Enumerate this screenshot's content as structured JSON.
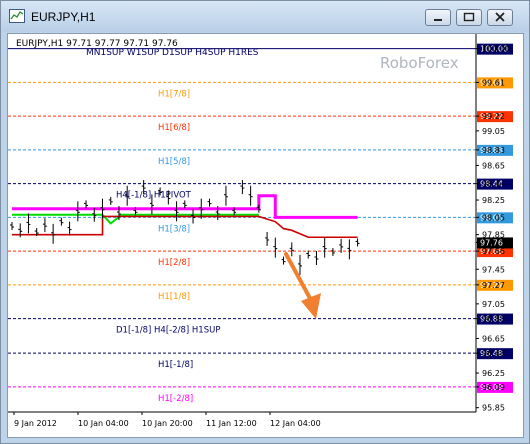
{
  "window": {
    "title": "EURJPY,H1",
    "icon": "chart-window-icon",
    "controls": [
      "minimize-icon",
      "maximize-icon",
      "close-icon"
    ]
  },
  "chart_info": {
    "symbol_line": "EURJPY,H1  97.71 97.77 97.71 97.76",
    "levels_line": "MN1SUP W1SUP D1SUP H4SUP H1RES",
    "watermark": "RoboForex"
  },
  "colors": {
    "navy": "#000066",
    "orange": "#ff9900",
    "red": "#ff3300",
    "blue": "#3399dd",
    "magenta": "#ff00ff",
    "green": "#00dd00",
    "darkred": "#cc0000",
    "arrow": "#f08030"
  },
  "chart_data": {
    "type": "line",
    "ylim": [
      95.8,
      100.1
    ],
    "y_ticks": [
      "100.00",
      "99.61",
      "99.22",
      "99.05",
      "98.83",
      "98.65",
      "98.44",
      "98.25",
      "98.05",
      "97.85",
      "97.76",
      "97.66",
      "97.45",
      "97.27",
      "97.05",
      "96.88",
      "96.65",
      "96.48",
      "96.25",
      "96.09",
      "95.85"
    ],
    "x_ticks": [
      "9 Jan 2012",
      "10 Jan 04:00",
      "10 Jan 20:00",
      "11 Jan 12:00",
      "12 Jan 04:00"
    ],
    "levels": [
      {
        "value": 100.0,
        "label": "",
        "color": "navy",
        "tag": "100.00",
        "style": "solid"
      },
      {
        "value": 99.61,
        "label": "H1[7/8]",
        "color": "orange",
        "tag": "99.61",
        "style": "dash"
      },
      {
        "value": 99.22,
        "label": "H1[6/8]",
        "color": "red",
        "tag": "99.22",
        "style": "dash"
      },
      {
        "value": 98.83,
        "label": "H1[5/8]",
        "color": "blue",
        "tag": "98.83",
        "style": "dash"
      },
      {
        "value": 98.44,
        "label": "H4[-1/8] H1PIVOT",
        "color": "navy",
        "tag": "98.44",
        "style": "dash"
      },
      {
        "value": 98.05,
        "label": "H1[3/8]",
        "color": "blue",
        "tag": "98.05",
        "style": "dash"
      },
      {
        "value": 97.66,
        "label": "H1[2/8]",
        "color": "red",
        "tag": "97.66",
        "style": "dash"
      },
      {
        "value": 97.27,
        "label": "H1[1/8]",
        "color": "orange",
        "tag": "97.27",
        "style": "dash"
      },
      {
        "value": 96.88,
        "label": "D1[-1/8] H4[-2/8] H1SUP",
        "color": "navy",
        "tag": "96.88",
        "style": "dash"
      },
      {
        "value": 96.48,
        "label": "H1[-1/8]",
        "color": "navy",
        "tag": "96.48",
        "style": "dash"
      },
      {
        "value": 96.09,
        "label": "H1[-2/8]",
        "color": "magenta",
        "tag": "96.09",
        "style": "dash"
      }
    ],
    "current_price": {
      "value": 97.76,
      "tag": "97.76"
    },
    "price_series": [
      {
        "x": 0,
        "y": 97.95
      },
      {
        "x": 3,
        "y": 97.9
      },
      {
        "x": 6,
        "y": 97.98
      },
      {
        "x": 9,
        "y": 97.88
      },
      {
        "x": 12,
        "y": 97.96
      },
      {
        "x": 15,
        "y": 97.86
      },
      {
        "x": 18,
        "y": 98.0
      },
      {
        "x": 21,
        "y": 97.92
      },
      {
        "x": 24,
        "y": 98.12
      },
      {
        "x": 27,
        "y": 98.2
      },
      {
        "x": 30,
        "y": 98.08
      },
      {
        "x": 33,
        "y": 98.15
      },
      {
        "x": 36,
        "y": 98.24
      },
      {
        "x": 39,
        "y": 98.1
      },
      {
        "x": 42,
        "y": 98.3
      },
      {
        "x": 45,
        "y": 98.12
      },
      {
        "x": 48,
        "y": 98.4
      },
      {
        "x": 51,
        "y": 98.2
      },
      {
        "x": 54,
        "y": 98.35
      },
      {
        "x": 57,
        "y": 98.28
      },
      {
        "x": 60,
        "y": 98.12
      },
      {
        "x": 63,
        "y": 98.2
      },
      {
        "x": 66,
        "y": 98.06
      },
      {
        "x": 69,
        "y": 98.15
      },
      {
        "x": 72,
        "y": 98.22
      },
      {
        "x": 75,
        "y": 98.1
      },
      {
        "x": 78,
        "y": 98.3
      },
      {
        "x": 81,
        "y": 98.12
      },
      {
        "x": 84,
        "y": 98.4
      },
      {
        "x": 87,
        "y": 98.3
      },
      {
        "x": 90,
        "y": 98.15
      },
      {
        "x": 93,
        "y": 97.8
      },
      {
        "x": 96,
        "y": 97.7
      },
      {
        "x": 99,
        "y": 97.55
      },
      {
        "x": 102,
        "y": 97.68
      },
      {
        "x": 105,
        "y": 97.5
      },
      {
        "x": 108,
        "y": 97.62
      },
      {
        "x": 111,
        "y": 97.58
      },
      {
        "x": 114,
        "y": 97.7
      },
      {
        "x": 117,
        "y": 97.65
      },
      {
        "x": 120,
        "y": 97.72
      },
      {
        "x": 123,
        "y": 97.68
      },
      {
        "x": 126,
        "y": 97.76
      }
    ],
    "magenta_line": [
      {
        "x": 0,
        "y": 98.15
      },
      {
        "x": 90,
        "y": 98.15
      },
      {
        "x": 90,
        "y": 98.3
      },
      {
        "x": 96,
        "y": 98.3
      },
      {
        "x": 96,
        "y": 98.05
      },
      {
        "x": 126,
        "y": 98.05
      }
    ],
    "green_line": [
      {
        "x": 0,
        "y": 98.08
      },
      {
        "x": 33,
        "y": 98.08
      },
      {
        "x": 36,
        "y": 97.98
      },
      {
        "x": 40,
        "y": 98.08
      },
      {
        "x": 90,
        "y": 98.08
      }
    ],
    "red_line": [
      {
        "x": 0,
        "y": 97.85
      },
      {
        "x": 33,
        "y": 97.85
      },
      {
        "x": 33,
        "y": 98.06
      },
      {
        "x": 90,
        "y": 98.06
      },
      {
        "x": 96,
        "y": 98.0
      },
      {
        "x": 99,
        "y": 97.92
      },
      {
        "x": 102,
        "y": 97.9
      },
      {
        "x": 108,
        "y": 97.82
      },
      {
        "x": 126,
        "y": 97.82
      }
    ],
    "x_range": [
      0,
      140
    ]
  }
}
